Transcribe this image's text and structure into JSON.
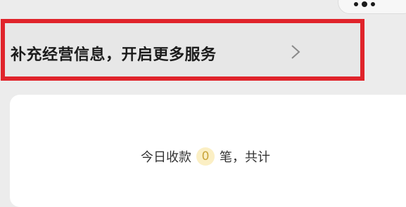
{
  "top_bar": {
    "more_icon": "three-dots-icon"
  },
  "banner": {
    "text": "补充经营信息，开启更多服务",
    "chevron_icon": "chevron-right-icon",
    "highlight_color": "#e0242b"
  },
  "summary": {
    "prefix": "今日收款",
    "count": "0",
    "suffix": "笔，共计"
  },
  "colors": {
    "badge_background": "#fbefc4",
    "badge_text": "#c9a53a"
  }
}
